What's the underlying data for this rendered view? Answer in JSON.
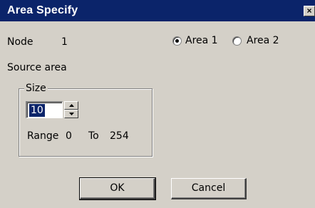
{
  "window": {
    "title": "Area Specify",
    "close_glyph": "×"
  },
  "node": {
    "label": "Node",
    "value": "1"
  },
  "area_select": {
    "options": [
      {
        "label": "Area 1",
        "selected": true
      },
      {
        "label": "Area 2",
        "selected": false
      }
    ]
  },
  "source_area_label": "Source area",
  "size_group": {
    "legend": "Size",
    "value": "10",
    "range_label": "Range",
    "range_min": "0",
    "range_to_label": "To",
    "range_max": "254"
  },
  "buttons": {
    "ok": "OK",
    "cancel": "Cancel"
  },
  "colors": {
    "titlebar": "#0b246a",
    "dialog_bg": "#d4d0c8",
    "selection": "#0b246a"
  }
}
